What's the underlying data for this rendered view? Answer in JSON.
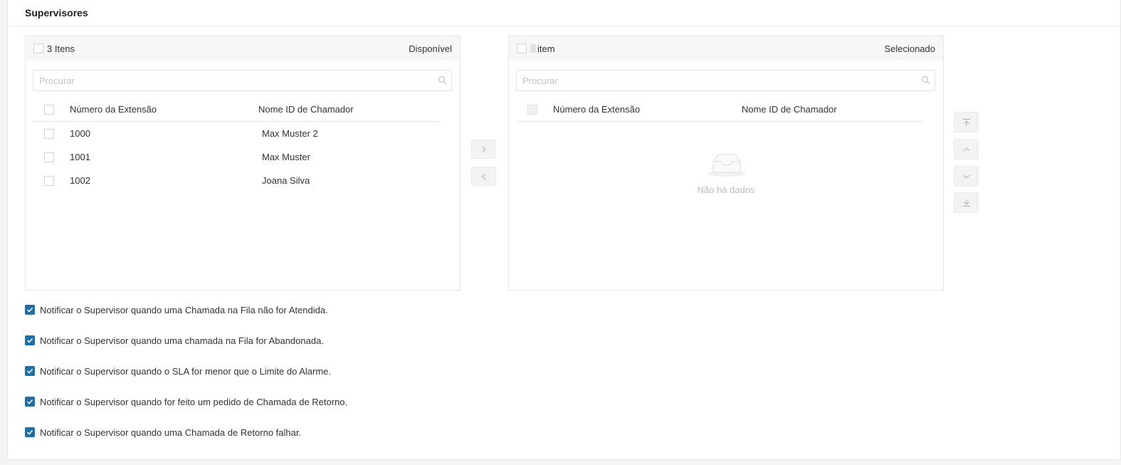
{
  "section": {
    "title": "Supervisores"
  },
  "available": {
    "count_label": "3 Itens",
    "title": "Disponível",
    "search_placeholder": "Procurar",
    "columns": [
      "Número da Extensão",
      "Nome ID de Chamador"
    ],
    "rows": [
      {
        "ext": "1000",
        "name": "Max Muster 2"
      },
      {
        "ext": "1001",
        "name": "Max Muster"
      },
      {
        "ext": "1002",
        "name": "Joana Silva"
      }
    ]
  },
  "selected": {
    "count_label": "item",
    "title": "Selecionado",
    "search_placeholder": "Procurar",
    "columns": [
      "Número da Extensão",
      "Nome ID de Chamador"
    ],
    "empty_text": "Não há dados"
  },
  "transfer_buttons": {
    "to_right_icon": "chevron-right-icon",
    "to_left_icon": "chevron-left-icon"
  },
  "order_buttons": [
    "move-top-icon",
    "move-up-icon",
    "move-down-icon",
    "move-bottom-icon"
  ],
  "options": [
    {
      "label": "Notificar o Supervisor quando uma Chamada na Fila não for Atendida.",
      "checked": true
    },
    {
      "label": "Notificar o Supervisor quando uma chamada na Fila for Abandonada.",
      "checked": true
    },
    {
      "label": "Notificar o Supervisor quando o SLA for menor que o Limite do Alarme.",
      "checked": true
    },
    {
      "label": "Notificar o Supervisor quando for feito um pedido de Chamada de Retorno.",
      "checked": true
    },
    {
      "label": "Notificar o Supervisor quando uma Chamada de Retorno falhar.",
      "checked": true
    }
  ],
  "colors": {
    "checkbox_checked": "#1c6fa8",
    "panel_header": "#f6f7f8"
  }
}
